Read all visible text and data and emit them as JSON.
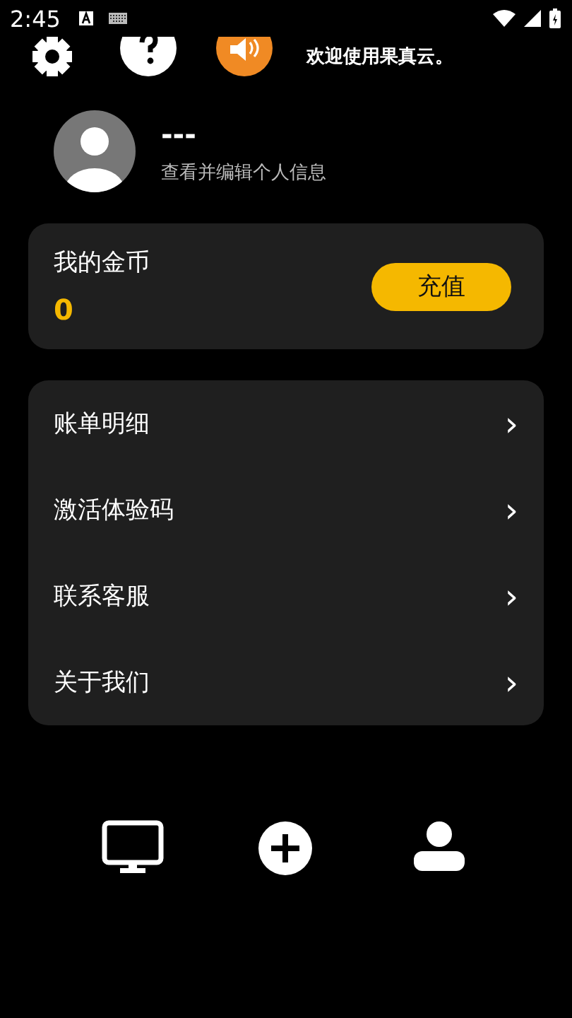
{
  "status_bar": {
    "time": "2:45"
  },
  "header": {
    "welcome": "欢迎使用果真云。"
  },
  "profile": {
    "name": "---",
    "subtitle": "查看并编辑个人信息"
  },
  "coins": {
    "title": "我的金币",
    "amount": "0",
    "button": "充值"
  },
  "menu": [
    {
      "label": "账单明细",
      "chevron": "›"
    },
    {
      "label": "激活体验码",
      "chevron": "›"
    },
    {
      "label": "联系客服",
      "chevron": "›"
    },
    {
      "label": "关于我们",
      "chevron": "›"
    }
  ],
  "bottom_nav": [
    {
      "kind": "monitor"
    },
    {
      "kind": "plus"
    },
    {
      "kind": "person"
    }
  ]
}
